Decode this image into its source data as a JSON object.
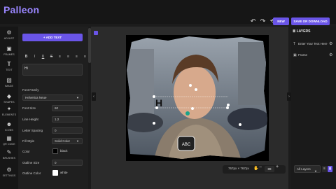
{
  "app": {
    "name": "Palleon"
  },
  "topbar": {
    "icons": [
      "undo-icon",
      "redo-icon",
      "history-icon"
    ],
    "new_label": "NEW",
    "save_label": "SAVE OR DOWNLOAD"
  },
  "rail": [
    {
      "icon": "adjust-icon",
      "glyph": "⚙",
      "label": "ADJUST"
    },
    {
      "icon": "frames-icon",
      "glyph": "▣",
      "label": "FRAMES"
    },
    {
      "icon": "text-icon",
      "glyph": "T",
      "label": "TEXT"
    },
    {
      "icon": "image-icon",
      "glyph": "▨",
      "label": "IMAGE"
    },
    {
      "icon": "shapes-icon",
      "glyph": "◆",
      "label": "SHAPES"
    },
    {
      "icon": "elements-icon",
      "glyph": "✦",
      "label": "ELEMENTS"
    },
    {
      "icon": "icons-icon",
      "glyph": "☻",
      "label": "ICONS"
    },
    {
      "icon": "qr-code-icon",
      "glyph": "▦",
      "label": "QR CODE"
    },
    {
      "icon": "brushes-icon",
      "glyph": "✎",
      "label": "BRUSHES"
    },
    {
      "icon": "settings-icon",
      "glyph": "⚙",
      "label": "SETTINGS"
    }
  ],
  "panel": {
    "add_text": "ADD TEXT",
    "text_value": "Hi",
    "font_family_label": "Font Family",
    "font_family_value": "Helvetica Neue",
    "font_size_label": "Font Size",
    "font_size_value": "60",
    "line_height_label": "Line Height",
    "line_height_value": "1.2",
    "letter_spacing_label": "Letter Spacing",
    "letter_spacing_value": "0",
    "fill_style_label": "Fill Style",
    "fill_style_value": "Solid Color",
    "color_label": "Color",
    "color_value": "black",
    "outline_size_label": "Outline Size",
    "outline_size_value": "0",
    "outline_color_label": "Outline Color",
    "outline_color_value": "white"
  },
  "canvas": {
    "size_label": "767px × 767px",
    "zoom_value": "89",
    "photo_text": "H",
    "badge_text": "ABC"
  },
  "layers": {
    "title": "LAYERS",
    "items": [
      "Enter Your Text Here",
      "Frame"
    ],
    "filter_value": "All Layers"
  },
  "colors": {
    "accent": "#6a55e8",
    "logo": "#9a86ff"
  }
}
